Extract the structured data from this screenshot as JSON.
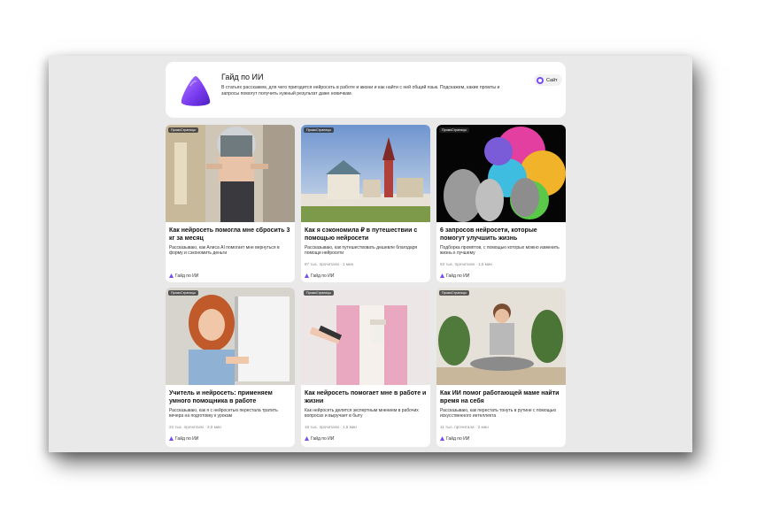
{
  "channel": {
    "title": "Гайд по ИИ",
    "description": "В статьях расскажем, для чего пригодится нейросеть в работе и жизни и как найти с ней общий язык. Подскажем, какие промты и запросы помогут получить нужный результат даже новичкам.",
    "site_label": "Сайт"
  },
  "articles": [
    {
      "partner": "ПромоСтраницы",
      "title": "Как нейросеть помогла мне сбросить 3 кг за месяц",
      "description": "Рассказываю, как Алиса AI помогает мне вернуться в форму и сэкономить деньги",
      "meta": "",
      "source": "Гайд по ИИ"
    },
    {
      "partner": "ПромоСтраницы",
      "title": "Как я сэкономила ₽ в путешествии с помощью нейросети",
      "description": "Рассказываю, как путешествовать дешевле благодаря помощи нейросети",
      "meta": "87 тыс. прочитали · 1 мин",
      "source": "Гайд по ИИ"
    },
    {
      "partner": "ПромоСтраницы",
      "title": "6 запросов нейросети, которые помогут улучшить жизнь",
      "description": "Подборка промптов, с помощью которых можно изменить жизнь к лучшему",
      "meta": "53 тыс. прочитали · 1,5 мин",
      "source": "Гайд по ИИ"
    },
    {
      "partner": "ПромоСтраницы",
      "title": "Учитель и нейросеть: применяем умного помощника в работе",
      "description": "Рассказываю, как я с нейросетью перестала тратить вечера на подготовку к урокам",
      "meta": "22 тыс. прочитали · 3,5 мин",
      "source": "Гайд по ИИ"
    },
    {
      "partner": "ПромоСтраницы",
      "title": "Как нейросеть помогает мне в работе и жизни",
      "description": "Как нейросеть делится экспертным мнением в рабочих вопросах и выручает в быту",
      "meta": "18 тыс. прочитали · 1,5 мин",
      "source": "Гайд по ИИ"
    },
    {
      "partner": "ПромоСтраницы",
      "title": "Как ИИ помог работающей маме найти время на себя",
      "description": "Рассказываю, как перестать тонуть в рутине с помощью искусственного интеллекта",
      "meta": "11 тыс. прочитали · 2 мин",
      "source": "Гайд по ИИ"
    }
  ],
  "colors": {
    "brand_purple": "#7a4cf5",
    "screen_bg": "#e9e9e9"
  },
  "icons": [
    "alice-logo-icon",
    "site-icon"
  ]
}
